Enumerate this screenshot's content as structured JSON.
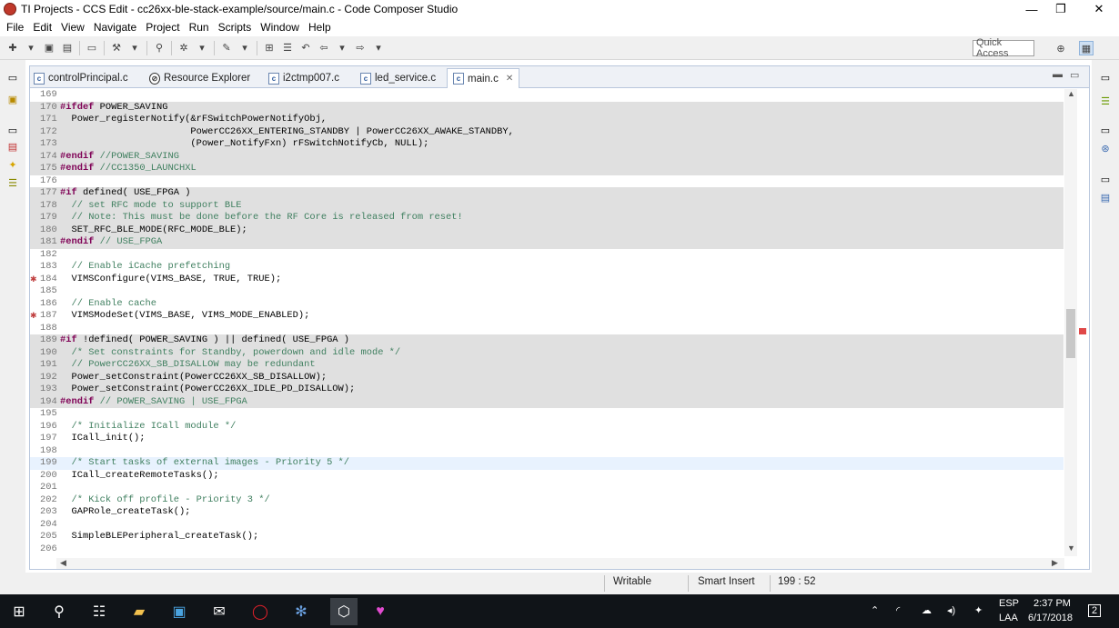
{
  "window": {
    "title": "TI Projects - CCS Edit - cc26xx-ble-stack-example/source/main.c - Code Composer Studio"
  },
  "menu": [
    "File",
    "Edit",
    "View",
    "Navigate",
    "Project",
    "Run",
    "Scripts",
    "Window",
    "Help"
  ],
  "toolbar": {
    "quick_access": "Quick Access"
  },
  "tabs": [
    {
      "label": "controlPrincipal.c",
      "icon": "c-file-icon"
    },
    {
      "label": "Resource Explorer",
      "icon": "resource-explorer-icon"
    },
    {
      "label": "i2ctmp007.c",
      "icon": "c-file-icon"
    },
    {
      "label": "led_service.c",
      "icon": "c-file-icon"
    },
    {
      "label": "main.c",
      "icon": "c-file-icon",
      "active": true
    }
  ],
  "code": [
    {
      "n": "169",
      "t": "",
      "shade": false
    },
    {
      "n": "170",
      "t": "#ifdef POWER_SAVING",
      "shade": true
    },
    {
      "n": "171",
      "t": "  Power_registerNotify(&rFSwitchPowerNotifyObj,",
      "shade": true
    },
    {
      "n": "172",
      "t": "                       PowerCC26XX_ENTERING_STANDBY | PowerCC26XX_AWAKE_STANDBY,",
      "shade": true
    },
    {
      "n": "173",
      "t": "                       (Power_NotifyFxn) rFSwitchNotifyCb, NULL);",
      "shade": true
    },
    {
      "n": "174",
      "t": "#endif //POWER_SAVING",
      "shade": true
    },
    {
      "n": "175",
      "t": "#endif //CC1350_LAUNCHXL",
      "shade": true
    },
    {
      "n": "176",
      "t": "",
      "shade": false
    },
    {
      "n": "177",
      "t": "#if defined( USE_FPGA )",
      "shade": true
    },
    {
      "n": "178",
      "t": "  // set RFC mode to support BLE",
      "shade": true
    },
    {
      "n": "179",
      "t": "  // Note: This must be done before the RF Core is released from reset!",
      "shade": true
    },
    {
      "n": "180",
      "t": "  SET_RFC_BLE_MODE(RFC_MODE_BLE);",
      "shade": true
    },
    {
      "n": "181",
      "t": "#endif // USE_FPGA",
      "shade": true
    },
    {
      "n": "182",
      "t": "",
      "shade": false
    },
    {
      "n": "183",
      "t": "  // Enable iCache prefetching",
      "shade": false
    },
    {
      "n": "184",
      "t": "  VIMSConfigure(VIMS_BASE, TRUE, TRUE);",
      "shade": false,
      "warn": true
    },
    {
      "n": "185",
      "t": "",
      "shade": false
    },
    {
      "n": "186",
      "t": "  // Enable cache",
      "shade": false
    },
    {
      "n": "187",
      "t": "  VIMSModeSet(VIMS_BASE, VIMS_MODE_ENABLED);",
      "shade": false,
      "warn": true
    },
    {
      "n": "188",
      "t": "",
      "shade": false
    },
    {
      "n": "189",
      "t": "#if !defined( POWER_SAVING ) || defined( USE_FPGA )",
      "shade": true
    },
    {
      "n": "190",
      "t": "  /* Set constraints for Standby, powerdown and idle mode */",
      "shade": true
    },
    {
      "n": "191",
      "t": "  // PowerCC26XX_SB_DISALLOW may be redundant",
      "shade": true
    },
    {
      "n": "192",
      "t": "  Power_setConstraint(PowerCC26XX_SB_DISALLOW);",
      "shade": true
    },
    {
      "n": "193",
      "t": "  Power_setConstraint(PowerCC26XX_IDLE_PD_DISALLOW);",
      "shade": true
    },
    {
      "n": "194",
      "t": "#endif // POWER_SAVING | USE_FPGA",
      "shade": true
    },
    {
      "n": "195",
      "t": "",
      "shade": false
    },
    {
      "n": "196",
      "t": "  /* Initialize ICall module */",
      "shade": false
    },
    {
      "n": "197",
      "t": "  ICall_init();",
      "shade": false
    },
    {
      "n": "198",
      "t": "",
      "shade": false
    },
    {
      "n": "199",
      "t": "  /* Start tasks of external images - Priority 5 */",
      "shade": false,
      "current": true
    },
    {
      "n": "200",
      "t": "  ICall_createRemoteTasks();",
      "shade": false
    },
    {
      "n": "201",
      "t": "",
      "shade": false
    },
    {
      "n": "202",
      "t": "  /* Kick off profile - Priority 3 */",
      "shade": false
    },
    {
      "n": "203",
      "t": "  GAPRole_createTask();",
      "shade": false
    },
    {
      "n": "204",
      "t": "",
      "shade": false
    },
    {
      "n": "205",
      "t": "  SimpleBLEPeripheral_createTask();",
      "shade": false
    },
    {
      "n": "206",
      "t": "",
      "shade": false
    }
  ],
  "status": {
    "mode": "Writable",
    "insert": "Smart Insert",
    "position": "199 : 52"
  },
  "taskbar": {
    "lang1": "ESP",
    "lang2": "LAA",
    "time": "2:37 PM",
    "date": "6/17/2018",
    "notifications": "2"
  },
  "colors": {
    "keyword": "#7f0055",
    "comment": "#3f7f5f",
    "inactive_block": "#e0e0e0",
    "current_line": "#e8f2fe"
  }
}
